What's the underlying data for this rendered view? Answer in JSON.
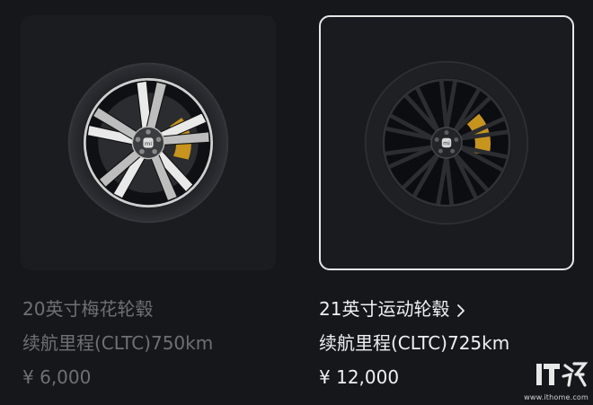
{
  "options": [
    {
      "title": "20英寸梅花轮毂",
      "range": "续航里程(CLTC)750km",
      "currency": "¥",
      "price": "6,000",
      "selected": false,
      "wheel_icon": "silver-5-spoke-wheel"
    },
    {
      "title": "21英寸运动轮毂",
      "range": "续航里程(CLTC)725km",
      "currency": "¥",
      "price": "12,000",
      "selected": true,
      "wheel_icon": "black-multispoke-wheel",
      "has_chevron": true
    }
  ],
  "watermark": {
    "logo": "IT之家",
    "url": "www.ithome.com"
  },
  "colors": {
    "background": "#15171b",
    "selected_border": "#e7e7e7",
    "text_muted": "#6e7075",
    "text_bright": "#eef0f3",
    "caliper": "#c8951c"
  }
}
